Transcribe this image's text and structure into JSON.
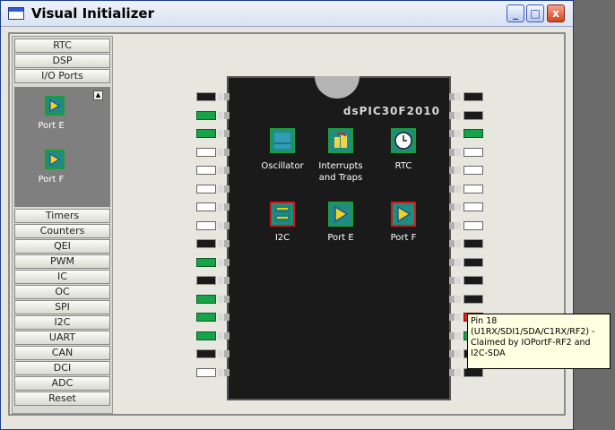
{
  "window": {
    "title": "Visual Initializer",
    "buttons": {
      "minimize": "_",
      "maximize": "□",
      "close": "x"
    }
  },
  "sidebar": {
    "top_buttons": [
      {
        "label": "RTC"
      },
      {
        "label": "DSP"
      },
      {
        "label": "I/O Ports"
      }
    ],
    "panel_items": [
      {
        "label": "Port E",
        "icon": "port-icon"
      },
      {
        "label": "Port F",
        "icon": "port-icon"
      }
    ],
    "bottom_buttons": [
      {
        "label": "Timers"
      },
      {
        "label": "Counters"
      },
      {
        "label": "QEI"
      },
      {
        "label": "PWM"
      },
      {
        "label": "IC"
      },
      {
        "label": "OC"
      },
      {
        "label": "SPI"
      },
      {
        "label": "I2C"
      },
      {
        "label": "UART"
      },
      {
        "label": "CAN"
      },
      {
        "label": "DCI"
      },
      {
        "label": "ADC"
      },
      {
        "label": "Reset"
      }
    ]
  },
  "chip": {
    "name": "dsPIC30F2010",
    "modules": [
      {
        "label": "Oscillator",
        "icon": "oscillator-icon"
      },
      {
        "label": "Interrupts\nand Traps",
        "label_line1": "Interrupts",
        "label_line2": "and Traps",
        "icon": "interrupts-icon"
      },
      {
        "label": "RTC",
        "icon": "clock-icon"
      },
      {
        "label": "I2C",
        "icon": "i2c-icon"
      },
      {
        "label": "Port E",
        "icon": "port-icon"
      },
      {
        "label": "Port F",
        "icon": "port-icon"
      }
    ],
    "left_pins": [
      "black",
      "green",
      "green",
      "white",
      "white",
      "white",
      "white",
      "white",
      "black",
      "green",
      "black",
      "green",
      "green",
      "green",
      "black",
      "white"
    ],
    "right_pins": [
      "black",
      "black",
      "green",
      "white",
      "white",
      "white",
      "white",
      "white",
      "black",
      "black",
      "black",
      "black",
      "red",
      "green",
      "black",
      "black"
    ]
  },
  "tooltip": {
    "line1": "Pin 18",
    "line2": "(U1RX/SDI1/SDA/C1RX/RF2) -",
    "line3": "Claimed by IOPortF-RF2 and",
    "line4": "I2C-SDA"
  }
}
